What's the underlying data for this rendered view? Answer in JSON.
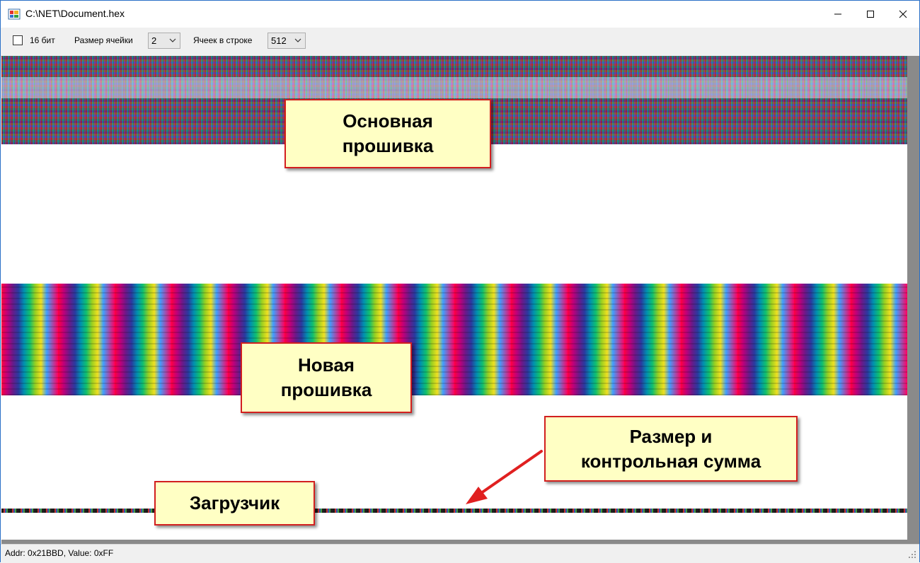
{
  "window": {
    "title": "C:\\NET\\Document.hex",
    "controls": {
      "minimize": "—",
      "maximize": "☐",
      "close": "✕"
    }
  },
  "toolbar": {
    "checkbox_label": "16 бит",
    "checkbox_checked": false,
    "cell_size_label": "Размер ячейки",
    "cell_size_value": "2",
    "cells_per_row_label": "Ячеек в строке",
    "cells_per_row_value": "512"
  },
  "status": {
    "text": "Addr: 0x21BBD, Value: 0xFF"
  },
  "callouts": {
    "main_firmware": "Основная\nпрошивка",
    "new_firmware": "Новая\nпрошивка",
    "size_checksum": "Размер и\nконтрольная сумма",
    "bootloader": "Загрузчик"
  },
  "icons": {
    "app": "app-icon",
    "dropdown": "chevron-down-icon",
    "grip": "resize-grip-icon"
  },
  "colors": {
    "callout_fill": "#ffffc4",
    "callout_border": "#d21f1f",
    "arrow": "#e02020"
  }
}
